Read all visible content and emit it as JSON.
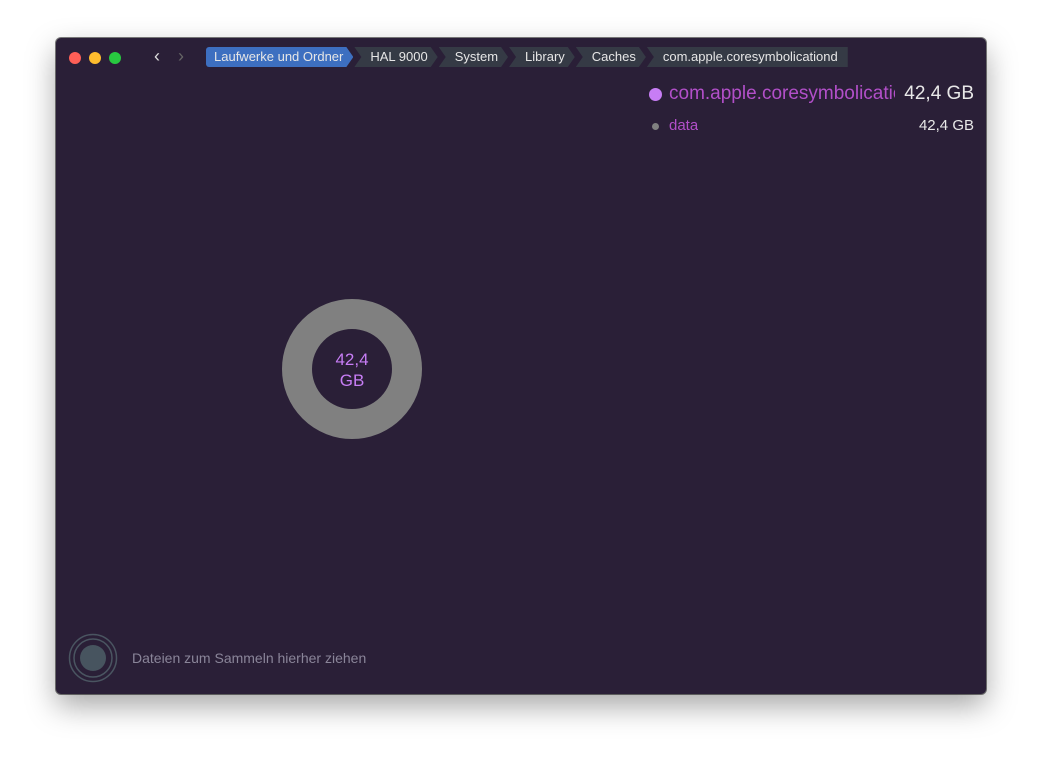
{
  "window": {
    "traffic_lights": {
      "close": "#fe5f57",
      "minimize": "#febc2e",
      "zoom": "#28c840"
    }
  },
  "nav": {
    "back_icon": "chevron-left-icon",
    "forward_icon": "chevron-right-icon"
  },
  "breadcrumb": [
    "Laufwerke und Ordner",
    "HAL 9000",
    "System",
    "Library",
    "Caches",
    "com.apple.coresymbolicationd"
  ],
  "legend": [
    {
      "name": "com.apple.coresymbolicationd",
      "size": "42,4 GB",
      "color": "#c77df5"
    },
    {
      "name": "data",
      "size": "42,4 GB",
      "color": "#808080"
    }
  ],
  "chart_data": {
    "type": "pie",
    "style": "donut",
    "slices": [
      {
        "label": "data",
        "value": 42.4,
        "unit": "GB",
        "color": "#808080"
      }
    ],
    "center_label": {
      "value": "42,4",
      "unit": "GB"
    }
  },
  "footer": {
    "drop_hint": "Dateien zum Sammeln hierher ziehen"
  }
}
